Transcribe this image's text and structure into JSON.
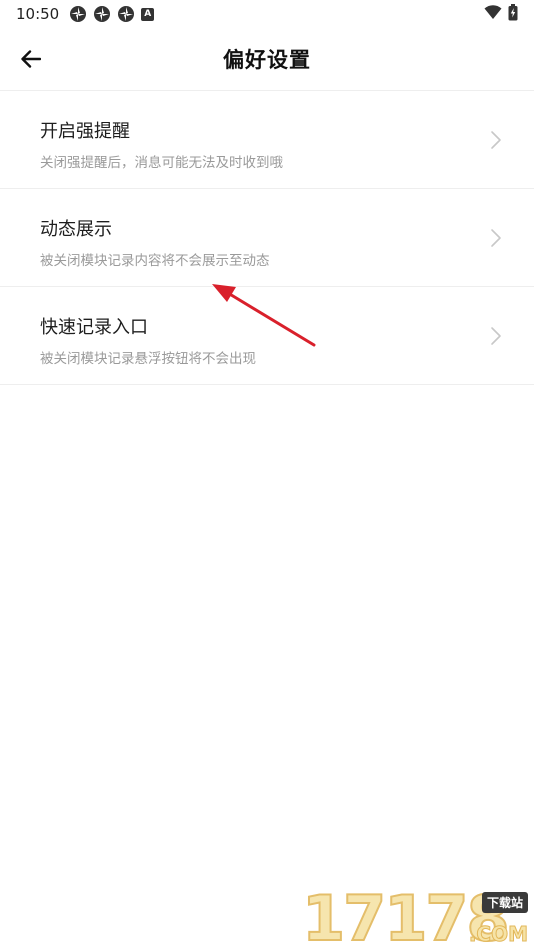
{
  "status_bar": {
    "time": "10:50",
    "badge_letter": "A",
    "left_icons": [
      "flower-icon",
      "flower-icon",
      "flower-icon",
      "a-badge-icon"
    ],
    "right_icons": [
      "wifi-icon",
      "battery-icon"
    ]
  },
  "header": {
    "title": "偏好设置",
    "back_icon": "arrow-left-icon"
  },
  "settings": {
    "items": [
      {
        "title": "开启强提醒",
        "description": "关闭强提醒后，消息可能无法及时收到哦"
      },
      {
        "title": "动态展示",
        "description": "被关闭模块记录内容将不会展示至动态"
      },
      {
        "title": "快速记录入口",
        "description": "被关闭模块记录悬浮按钮将不会出现"
      }
    ]
  },
  "annotation": {
    "arrow_color": "#d9202b"
  },
  "watermark": {
    "digits": "17178",
    "badge": "下载站",
    "suffix": ".COM"
  },
  "colors": {
    "title": "#111111",
    "item_text": "#1e1e1e",
    "description": "#9a9a9a",
    "divider": "#eeeeee",
    "chevron": "#c8c8c8"
  }
}
